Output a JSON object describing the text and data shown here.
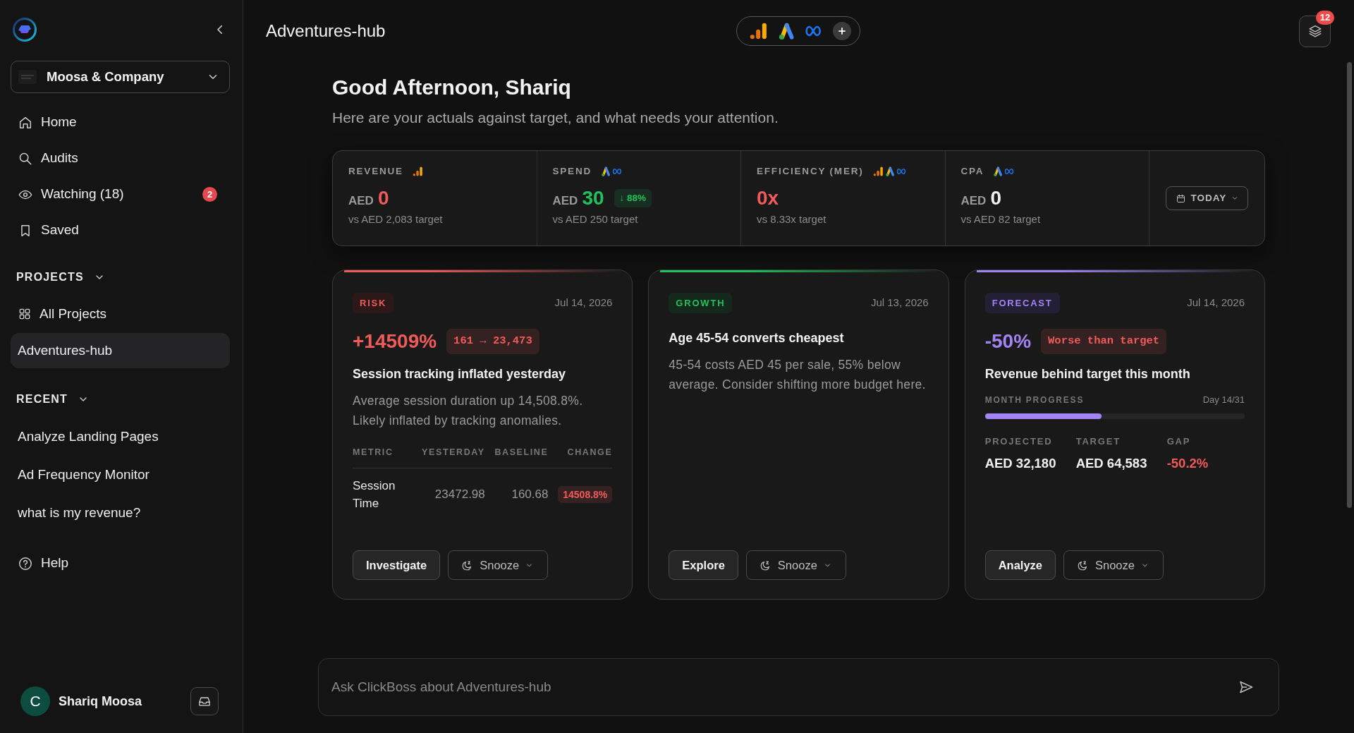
{
  "sidebar": {
    "company": {
      "name": "Moosa & Company"
    },
    "nav": [
      {
        "label": "Home",
        "selected": false
      },
      {
        "label": "Audits",
        "selected": false
      },
      {
        "label": "Watching (18)",
        "selected": false,
        "badge": "2"
      },
      {
        "label": "Saved",
        "selected": false
      }
    ],
    "projects": {
      "title": "PROJECTS",
      "expanded": true,
      "items": [
        {
          "label": "All Projects",
          "selected": false
        },
        {
          "label": "Adventures-hub",
          "selected": true
        }
      ]
    },
    "recent": {
      "title": "RECENT",
      "expanded": true,
      "items": [
        {
          "label": "Analyze Landing Pages",
          "selected": false
        },
        {
          "label": "Ad Frequency Monitor",
          "selected": false
        },
        {
          "label": "what is my revenue?",
          "selected": false
        }
      ]
    },
    "help": {
      "label": "Help"
    },
    "user": {
      "initial": "C",
      "name": "Shariq Moosa"
    }
  },
  "header": {
    "title": "Adventures-hub",
    "notification_count": "12"
  },
  "greeting": {
    "title": "Good Afternoon, Shariq",
    "subtitle": "Here are your actuals against target, and what needs your attention."
  },
  "kpis": [
    {
      "label": "REVENUE",
      "sources": [
        {
          "kind": "analytics"
        }
      ],
      "currency": "AED",
      "value": "0",
      "color": "#f25a5a",
      "target": "vs AED 2,083 target"
    },
    {
      "label": "SPEND",
      "sources": [
        {
          "kind": "ads"
        },
        {
          "kind": "meta"
        }
      ],
      "currency": "AED",
      "value": "30",
      "color": "#1fc25b",
      "change": {
        "text": "↓ 88%",
        "color": "#1fc25b"
      },
      "target": "vs AED 250 target"
    },
    {
      "label": "EFFICIENCY (MER)",
      "sources": [
        {
          "kind": "analytics"
        },
        {
          "kind": "ads"
        },
        {
          "kind": "meta"
        }
      ],
      "value": "0x",
      "color": "#f25a5a",
      "target": "vs 8.33x target"
    },
    {
      "label": "CPA",
      "sources": [
        {
          "kind": "ads"
        },
        {
          "kind": "meta"
        }
      ],
      "currency": "AED",
      "value": "0",
      "color": "#f0f0f0",
      "target": "vs AED 82 target"
    }
  ],
  "date_range": {
    "label": "TODAY"
  },
  "insights": [
    {
      "kind": "risk",
      "tag": "RISK",
      "date": "Jul 14, 2026",
      "headline": {
        "value": "+14509%",
        "badge": {
          "text": "161 → 23,473",
          "color": "#f25a5a"
        }
      },
      "title": "Session tracking inflated yesterday",
      "description": "Average session duration up 14,508.8%. Likely inflated by tracking anomalies.",
      "table": {
        "columns": [
          "METRIC",
          "YESTERDAY",
          "BASELINE",
          "CHANGE"
        ],
        "rows": [
          {
            "cells": [
              "Session Time",
              "23472.98",
              "160.68"
            ],
            "change": {
              "text": "14508.8%",
              "color": "#f25a5a"
            }
          }
        ]
      },
      "actions": [
        {
          "label": "Investigate",
          "kind": "primary"
        },
        {
          "label": "Snooze",
          "kind": "snooze"
        }
      ]
    },
    {
      "kind": "growth",
      "tag": "GROWTH",
      "date": "Jul 13, 2026",
      "title": "Age 45-54 converts cheapest",
      "description": "45-54 costs AED 45 per sale, 55% below average. Consider shifting more budget here.",
      "actions": [
        {
          "label": "Explore",
          "kind": "primary"
        },
        {
          "label": "Snooze",
          "kind": "snooze"
        }
      ]
    },
    {
      "kind": "forecast",
      "tag": "FORECAST",
      "date": "Jul 14, 2026",
      "headline": {
        "value": "-50%",
        "badge": {
          "text": "Worse than target",
          "color": "#f25a5a"
        }
      },
      "title": "Revenue behind target this month",
      "progress": {
        "label": "MONTH PROGRESS",
        "reading": "Day 14/31",
        "level": 0.45
      },
      "stats": [
        {
          "label": "PROJECTED",
          "value": "AED 32,180",
          "color": "#f0f0f0"
        },
        {
          "label": "TARGET",
          "value": "AED 64,583",
          "color": "#f0f0f0"
        },
        {
          "label": "GAP",
          "value": "-50.2%",
          "color": "#f25a5a"
        }
      ],
      "actions": [
        {
          "label": "Analyze",
          "kind": "primary"
        },
        {
          "label": "Snooze",
          "kind": "snooze"
        }
      ]
    }
  ],
  "chat": {
    "placeholder": "Ask ClickBoss about Adventures-hub"
  }
}
